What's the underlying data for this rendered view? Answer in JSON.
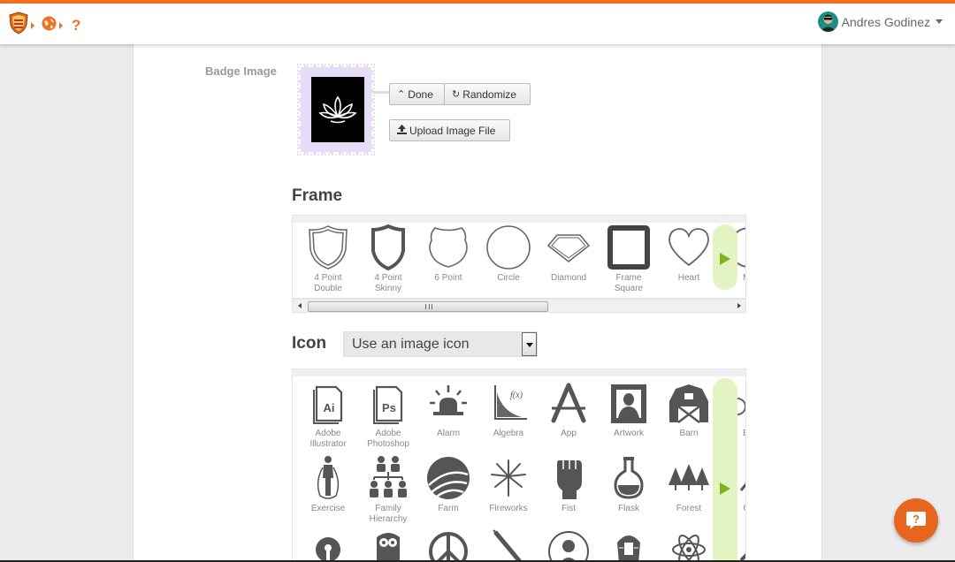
{
  "header": {
    "user_name": "Andres Godinez",
    "accent_color": "#f26e21",
    "icons": [
      "shield-logo-icon",
      "globe-icon",
      "help-icon"
    ],
    "help_glyph": "?"
  },
  "badge": {
    "label": "Badge Image",
    "image_icon": "lotus-icon",
    "frame_color": "#e6dcf7",
    "done_label": "Done",
    "randomize_label": "Randomize",
    "upload_label": "Upload Image File"
  },
  "frame_section": {
    "title": "Frame",
    "items": [
      {
        "line1": "4 Point",
        "line2": "Double",
        "icon": "shield-double-icon"
      },
      {
        "line1": "4 Point",
        "line2": "Skinny",
        "icon": "shield-skinny-icon"
      },
      {
        "line1": "6 Point",
        "line2": "",
        "icon": "shield-six-point-icon"
      },
      {
        "line1": "Circle",
        "line2": "",
        "icon": "circle-frame-icon"
      },
      {
        "line1": "Diamond",
        "line2": "",
        "icon": "diamond-frame-icon"
      },
      {
        "line1": "Frame",
        "line2": "Square",
        "icon": "square-frame-icon"
      },
      {
        "line1": "Heart",
        "line2": "",
        "icon": "heart-frame-icon"
      },
      {
        "line1": "Me",
        "line2": "",
        "icon": "medal-frame-icon"
      }
    ]
  },
  "icon_section": {
    "title": "Icon",
    "select_value": "Use an image icon",
    "rows": [
      [
        {
          "line1": "Adobe",
          "line2": "Illustrator",
          "icon": "adobe-illustrator-icon",
          "glyph": "Ai"
        },
        {
          "line1": "Adobe",
          "line2": "Photoshop",
          "icon": "adobe-photoshop-icon",
          "glyph": "Ps"
        },
        {
          "line1": "Alarm",
          "line2": "",
          "icon": "alarm-icon",
          "glyph": ""
        },
        {
          "line1": "Algebra",
          "line2": "",
          "icon": "algebra-icon",
          "glyph": "f(x)"
        },
        {
          "line1": "App",
          "line2": "",
          "icon": "app-icon",
          "glyph": ""
        },
        {
          "line1": "Artwork",
          "line2": "",
          "icon": "artwork-icon",
          "glyph": ""
        },
        {
          "line1": "Barn",
          "line2": "",
          "icon": "barn-icon",
          "glyph": ""
        },
        {
          "line1": "Bic",
          "line2": "",
          "icon": "bicycle-icon",
          "glyph": ""
        }
      ],
      [
        {
          "line1": "Exercise",
          "line2": "",
          "icon": "exercise-icon",
          "glyph": ""
        },
        {
          "line1": "Family",
          "line2": "Hierarchy",
          "icon": "family-hierarchy-icon",
          "glyph": ""
        },
        {
          "line1": "Farm",
          "line2": "",
          "icon": "farm-icon",
          "glyph": ""
        },
        {
          "line1": "Fireworks",
          "line2": "",
          "icon": "fireworks-icon",
          "glyph": ""
        },
        {
          "line1": "Fist",
          "line2": "",
          "icon": "fist-icon",
          "glyph": ""
        },
        {
          "line1": "Flask",
          "line2": "",
          "icon": "flask-icon",
          "glyph": ""
        },
        {
          "line1": "Forest",
          "line2": "",
          "icon": "forest-icon",
          "glyph": ""
        },
        {
          "line1": "Ga",
          "line2": "",
          "icon": "gavel-icon",
          "glyph": ""
        }
      ],
      [
        {
          "line1": "",
          "line2": "",
          "icon": "keyhole-icon",
          "glyph": ""
        },
        {
          "line1": "",
          "line2": "",
          "icon": "owl-icon",
          "glyph": ""
        },
        {
          "line1": "",
          "line2": "",
          "icon": "peace-icon",
          "glyph": ""
        },
        {
          "line1": "",
          "line2": "",
          "icon": "pen-icon",
          "glyph": ""
        },
        {
          "line1": "",
          "line2": "",
          "icon": "person-icon",
          "glyph": ""
        },
        {
          "line1": "",
          "line2": "",
          "icon": "pharaoh-icon",
          "glyph": ""
        },
        {
          "line1": "",
          "line2": "",
          "icon": "atom-icon",
          "glyph": ""
        },
        {
          "line1": "",
          "line2": "",
          "icon": "pencil-icon",
          "glyph": ""
        }
      ]
    ]
  },
  "chat": {
    "icon": "chat-help-icon",
    "glyph": "?",
    "color": "#e8651e"
  }
}
